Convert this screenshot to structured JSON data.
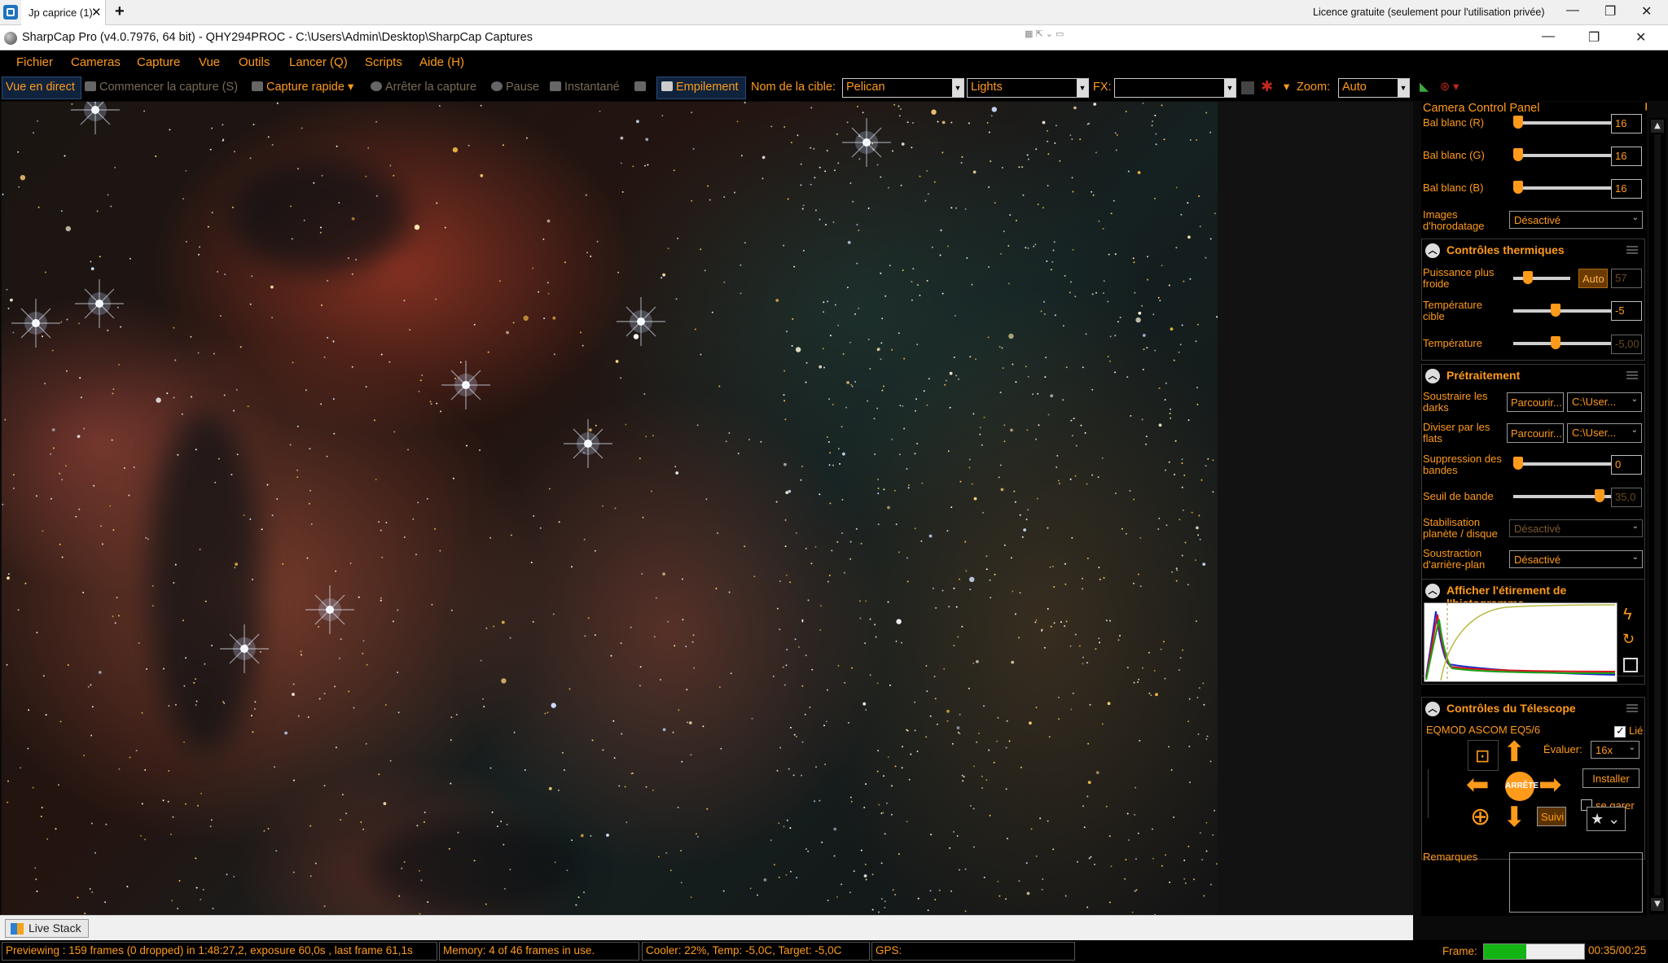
{
  "browser": {
    "tab_title": "Jp caprice (1)",
    "license": "Licence gratuite (seulement pour l'utilisation privée)"
  },
  "window": {
    "title": "SharpCap Pro (v4.0.7976, 64 bit) - QHY294PROC - C:\\Users\\Admin\\Desktop\\SharpCap Captures"
  },
  "menu": [
    "Fichier",
    "Cameras",
    "Capture",
    "Vue",
    "Outils",
    "Lancer (Q)",
    "Scripts",
    "Aide (H)"
  ],
  "toolbar": {
    "live_view": "Vue en direct",
    "start_capture": "Commencer la capture (S)",
    "quick_capture": "Capture rapide",
    "stop_capture": "Arrêter la capture",
    "pause": "Pause",
    "snapshot": "Instantané",
    "stacking": "Empilement",
    "target_label": "Nom de la cible:",
    "target_value": "Pelican",
    "frame_type": "Lights",
    "fx_label": "FX:",
    "fx_value": "",
    "zoom_label": "Zoom:",
    "zoom_value": "Auto"
  },
  "panel": {
    "title": "Camera Control Panel",
    "wb_r_label": "Bal blanc (R)",
    "wb_r_value": "16",
    "wb_r_level": 0.0,
    "wb_g_label": "Bal blanc (G)",
    "wb_g_value": "16",
    "wb_g_level": 0.0,
    "wb_b_label": "Bal blanc (B)",
    "wb_b_value": "16",
    "wb_b_level": 0.0,
    "timestamp_label": "Images d'horodatage",
    "timestamp_value": "Désactivé",
    "thermal": {
      "header": "Contrôles thermiques",
      "cooler_label": "Puissance plus froide",
      "cooler_auto": "Auto",
      "cooler_value": "57",
      "target_temp_label": "Température cible",
      "target_temp_value": "-5",
      "temp_label": "Température",
      "temp_value": "-5,00"
    },
    "preprocess": {
      "header": "Prétraitement",
      "darks_label": "Soustraire les darks",
      "darks_browse": "Parcourir...",
      "darks_path": "C:\\User...",
      "flats_label": "Diviser par les flats",
      "flats_browse": "Parcourir...",
      "flats_path": "C:\\User...",
      "banding_label": "Suppression des bandes",
      "banding_value": "0",
      "band_threshold_label": "Seuil de bande",
      "band_threshold_value": "35,0",
      "stabilization_label": "Stabilisation planète / disque",
      "stabilization_value": "Désactivé",
      "background_label": "Soustraction d'arrière-plan",
      "background_value": "Désactivé"
    },
    "histogram": {
      "header": "Afficher l'étirement de l'histogramme"
    },
    "telescope": {
      "header": "Contrôles du Télescope",
      "mount": "EQMOD ASCOM EQ5/6",
      "linked": "Lié",
      "rate_label": "Évaluer:",
      "rate_value": "16x",
      "install": "Installer",
      "park": "se garer",
      "stop": "ARRÊTE",
      "tracking": "Suivi"
    },
    "notes_label": "Remarques"
  },
  "livestack_tab": "Live Stack",
  "status": {
    "preview": "Previewing : 159 frames (0 dropped) in 1:48:27,2, exposure 60,0s , last frame 61,1s",
    "memory": "Memory: 4 of 46 frames in use.",
    "cooler": "Cooler: 22%, Temp: -5,0C, Target: -5,0C",
    "gps": "GPS:",
    "frame_label": "Frame:",
    "frame_progress": 0.42,
    "frame_time": "00:35/00:25"
  }
}
